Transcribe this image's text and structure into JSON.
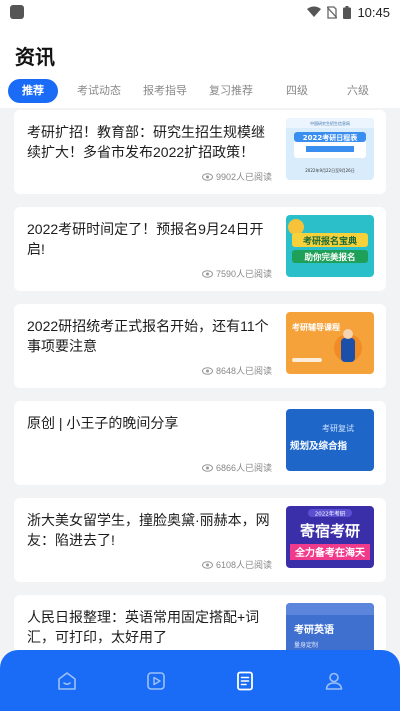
{
  "status_bar": {
    "time": "10:45",
    "icons": [
      "app-icon",
      "wifi-icon",
      "no-sim-icon",
      "battery-icon"
    ]
  },
  "header": {
    "title": "资讯"
  },
  "tabs": [
    {
      "label": "推荐",
      "active": true
    },
    {
      "label": "考试动态",
      "active": false
    },
    {
      "label": "报考指导",
      "active": false
    },
    {
      "label": "复习推荐",
      "active": false
    },
    {
      "label": "四级",
      "active": false
    },
    {
      "label": "六级",
      "active": false
    }
  ],
  "articles": [
    {
      "title": "考研扩招！教育部：研究生招生规模继续扩大！多省市发布2022扩招政策！",
      "views": "9902人已阅读",
      "thumb_text": "2022考研日程表",
      "thumb_date": "2022年9月22日至9月26日",
      "thumb_header": "中国研究生招生信息网"
    },
    {
      "title": "2022考研时间定了！预报名9月24日开启!",
      "views": "7590人已阅读",
      "thumb_text": "考研报名宝典",
      "thumb_sub": "助你完美报名"
    },
    {
      "title": "2022研招统考正式报名开始，还有11个事项要注意",
      "views": "8648人已阅读",
      "thumb_text": "考研辅导课程"
    },
    {
      "title": "原创 | 小王子的晚间分享",
      "views": "6866人已阅读",
      "thumb_text": "考研复试",
      "thumb_sub": "规划及综合指"
    },
    {
      "title": "浙大美女留学生，撞脸奥黛·丽赫本，网友：陷进去了!",
      "views": "6108人已阅读",
      "thumb_text": "寄宿考研",
      "thumb_top": "2022年考研",
      "thumb_sub": "全力备考在海天"
    },
    {
      "title": "人民日报整理：英语常用固定搭配+词汇，可打印，太好用了",
      "views": "",
      "thumb_text": "考研英语",
      "thumb_sub": "量身定制"
    }
  ],
  "bottom_nav": [
    {
      "icon": "home-icon"
    },
    {
      "icon": "play-icon"
    },
    {
      "icon": "document-icon",
      "active": true
    },
    {
      "icon": "profile-icon"
    }
  ],
  "colors": {
    "accent": "#1a6bf5",
    "background": "#f2f3f5"
  }
}
